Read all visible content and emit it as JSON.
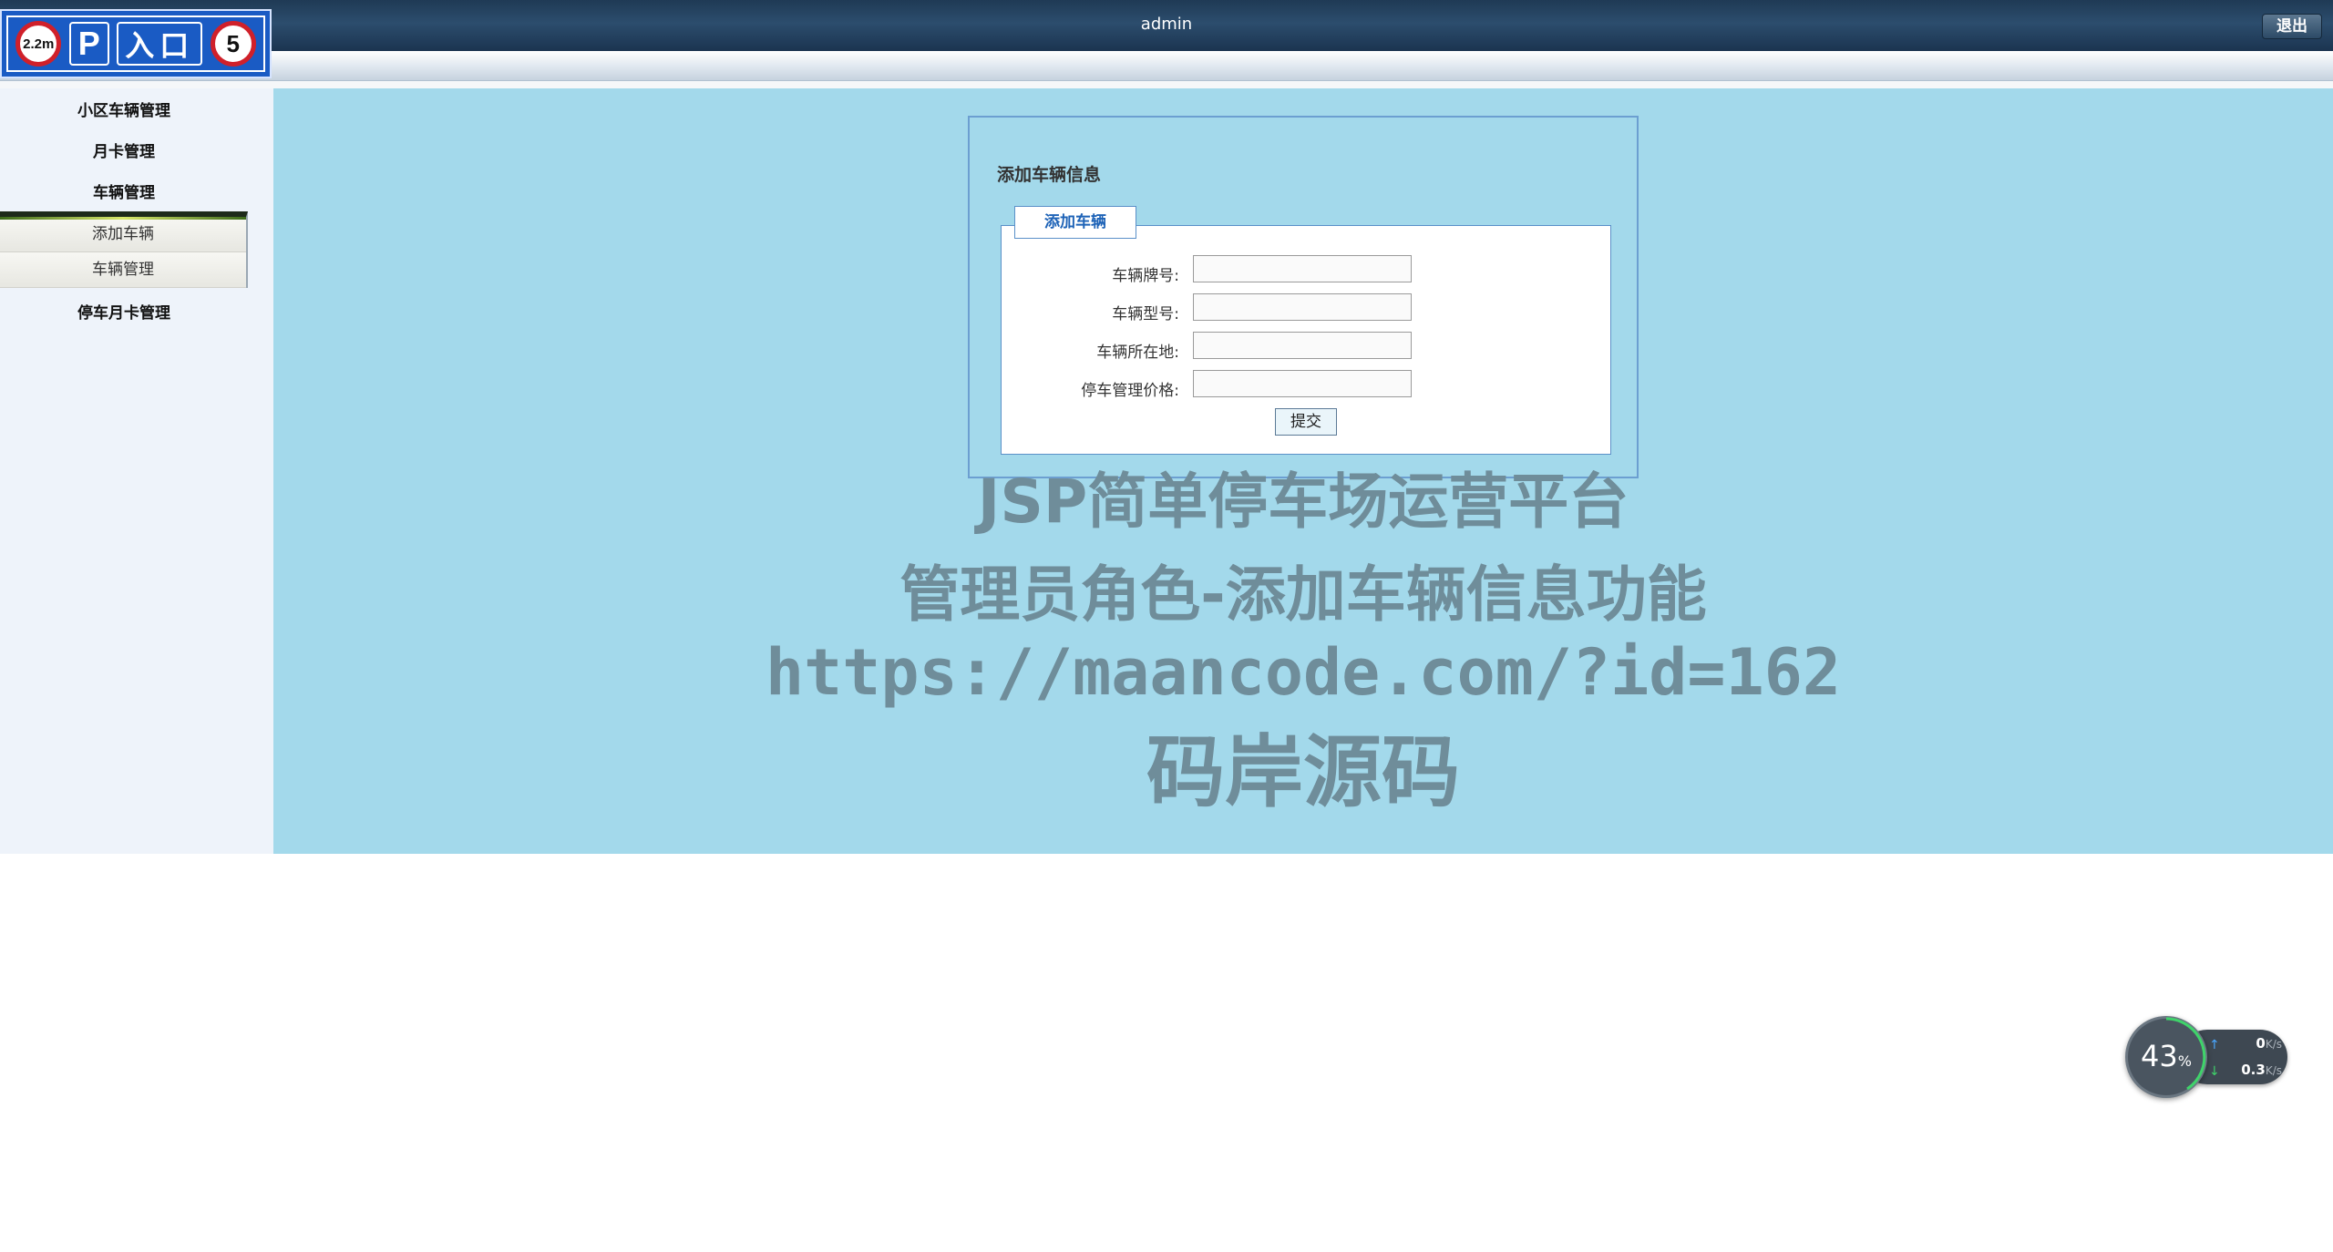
{
  "header": {
    "username": "admin",
    "logout_label": "退出"
  },
  "logo": {
    "height_limit": "2.2m",
    "parking_letter": "P",
    "entrance": "入口",
    "speed_limit": "5"
  },
  "sidebar": {
    "items": [
      {
        "label": "小区车辆管理"
      },
      {
        "label": "月卡管理"
      },
      {
        "label": "车辆管理"
      },
      {
        "label": "停车月卡管理"
      }
    ],
    "submenu": [
      {
        "label": "添加车辆"
      },
      {
        "label": "车辆管理"
      }
    ]
  },
  "form": {
    "page_title": "添加车辆信息",
    "legend": "添加车辆",
    "fields": [
      {
        "label": "车辆牌号:",
        "value": ""
      },
      {
        "label": "车辆型号:",
        "value": ""
      },
      {
        "label": "车辆所在地:",
        "value": ""
      },
      {
        "label": "停车管理价格:",
        "value": ""
      }
    ],
    "submit_label": "提交"
  },
  "watermark": {
    "line1": "JSP简单停车场运营平台",
    "line2": "管理员角色-添加车辆信息功能",
    "line3": "https://maancode.com/?id=162",
    "line4": "码岸源码"
  },
  "network_widget": {
    "cpu_percent": "43",
    "percent_sign": "%",
    "upload_value": "0",
    "upload_unit": "K/s",
    "download_value": "0.3",
    "download_unit": "K/s"
  },
  "colors": {
    "header_bg": "#1f3a55",
    "main_bg": "#a3d9eb",
    "sidebar_bg": "#eef3fa",
    "legend_text": "#1e63b7",
    "logo_blue": "#1a5bc4",
    "sign_red": "#d0202a"
  }
}
